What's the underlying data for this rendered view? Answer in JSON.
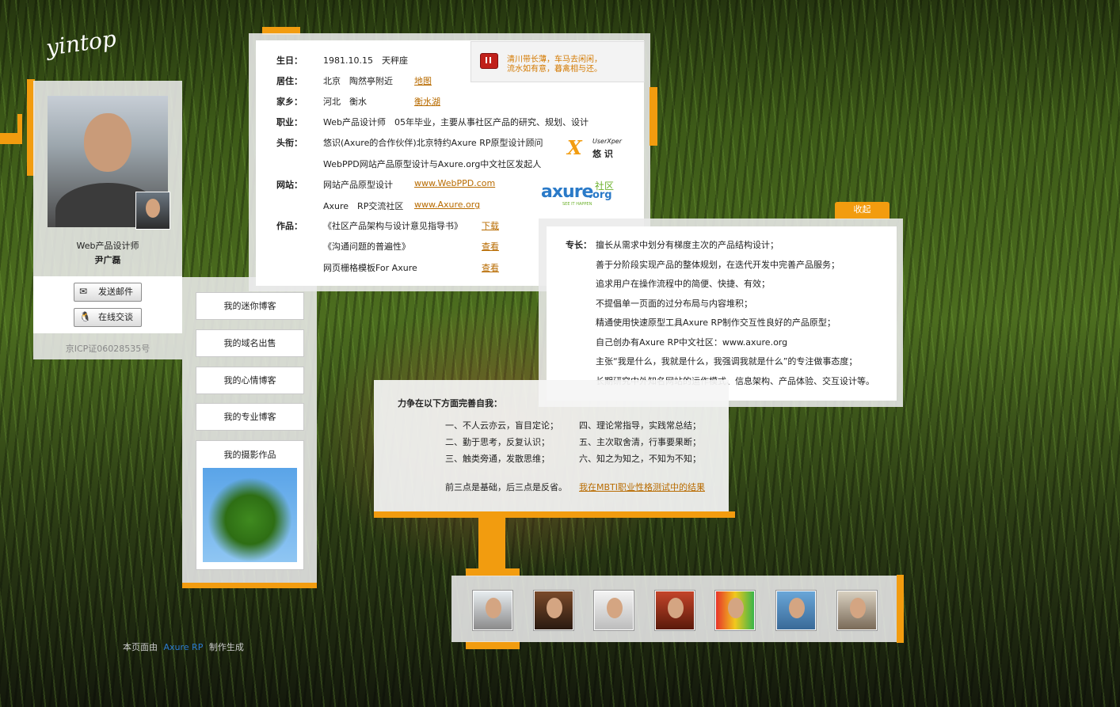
{
  "site": {
    "logo": "yintop"
  },
  "profile": {
    "title": "Web产品设计师",
    "name": "尹广磊",
    "send_mail": "发送邮件",
    "online_chat": "在线交谈",
    "icp": "京ICP证06028535号"
  },
  "info": {
    "birthday_label": "生日：",
    "birthday_value": "1981.10.15　天秤座",
    "residence_label": "居住：",
    "residence_value": "北京　陶然亭附近",
    "residence_link": "地图",
    "hometown_label": "家乡：",
    "hometown_value": "河北　衡水",
    "hometown_link": "衡水湖",
    "job_label": "职业：",
    "job_value": "Web产品设计师　05年毕业，主要从事社区产品的研究、规划、设计",
    "title_label": "头衔：",
    "title_line1": "悠识(Axure的合作伙伴)北京特约Axure RP原型设计顾问",
    "title_line2": "WebPPD网站产品原型设计与Axure.org中文社区发起人",
    "website_label": "网站：",
    "site1_name": "网站产品原型设计",
    "site1_link": "www.WebPPD.com",
    "site2_name": "Axure　RP交流社区",
    "site2_link": "www.Axure.org",
    "works_label": "作品：",
    "work1": "《社区产品架构与设计意见指导书》",
    "work1_link": "下载",
    "work2": "《沟通问题的普遍性》",
    "work2_link": "查看",
    "work3": "网页栅格模板For Axure",
    "work3_link": "查看",
    "userxper_brand": "UserXper",
    "userxper_cn": "悠 识",
    "axure_brand": "axure",
    "axure_org": ".org",
    "axure_community": "社区",
    "axure_tagline": "SEE IT HAPPEN"
  },
  "music": {
    "line1": "清川带长薄，车马去闲闲，",
    "line2": "流水如有意，暮禽相与还。"
  },
  "nav": [
    {
      "label": "我的迷你博客"
    },
    {
      "label": "我的域名出售"
    },
    {
      "label": "我的心情博客"
    },
    {
      "label": "我的专业博客"
    },
    {
      "label": "我的摄影作品"
    }
  ],
  "specialty": {
    "collapse": "收起",
    "label": "专长：",
    "items": [
      "擅长从需求中划分有梯度主次的产品结构设计；",
      "善于分阶段实现产品的整体规划，在迭代开发中完善产品服务；",
      "追求用户在操作流程中的简便、快捷、有效；",
      "不提倡单一页面的过分布局与内容堆积；",
      "精通使用快速原型工具Axure RP制作交互性良好的产品原型；",
      "自己创办有Axure RP中文社区：www.axure.org",
      "主张“我是什么，我就是什么，我强调我就是什么”的专注做事态度；",
      "长期研究中外知名网站的运作模式、信息架构、产品体验、交互设计等。"
    ]
  },
  "improve": {
    "title": "力争在以下方面完善自我：",
    "left": [
      "一、不人云亦云，盲目定论；",
      "二、勤于思考，反复认识；",
      "三、触类旁通，发散思维；"
    ],
    "right": [
      "四、理论常指导，实践常总结；",
      "五、主次取舍清，行事要果断；",
      "六、知之为知之，不知为不知；"
    ],
    "summary": "前三点是基础，后三点是反省。",
    "mbti_link": "我在MBTI职业性格测试中的结果"
  },
  "footer": {
    "prefix": "本页面由",
    "link": "Axure RP",
    "suffix": "制作生成"
  },
  "colors": {
    "accent": "#f29c0f",
    "link": "#b86b00",
    "play": "#c0201a"
  }
}
